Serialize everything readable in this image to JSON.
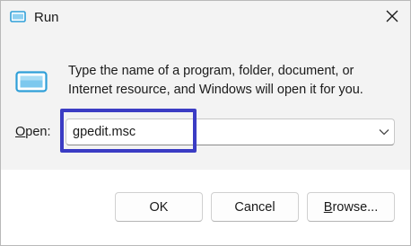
{
  "window": {
    "title": "Run",
    "title_icon": "run-icon",
    "close_icon": "close-icon"
  },
  "dialog": {
    "app_icon": "run-app-icon",
    "description": "Type the name of a program, folder, document, or Internet resource, and Windows will open it for you.",
    "open_label_mnemonic": "O",
    "open_label_rest": "pen:",
    "open_value": "gpedit.msc",
    "dropdown_icon": "chevron-down-icon"
  },
  "buttons": {
    "ok": "OK",
    "cancel": "Cancel",
    "browse_mnemonic": "B",
    "browse_rest": "rowse..."
  },
  "colors": {
    "highlight": "#3b3cc4",
    "icon_accent": "#2f9fd8",
    "background": "#f3f3f3"
  }
}
